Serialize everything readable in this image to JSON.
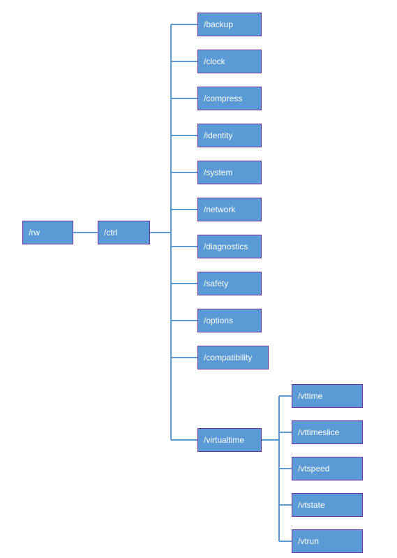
{
  "tree": {
    "root": {
      "label": "/rw",
      "children": [
        {
          "label": "/ctrl",
          "children": [
            {
              "label": "/backup"
            },
            {
              "label": "/clock"
            },
            {
              "label": "/compress"
            },
            {
              "label": "/identity"
            },
            {
              "label": "/system"
            },
            {
              "label": "/network"
            },
            {
              "label": "/diagnostics"
            },
            {
              "label": "/safety"
            },
            {
              "label": "/options"
            },
            {
              "label": "/compatibility"
            },
            {
              "label": "/virtualtime",
              "children": [
                {
                  "label": "/vttime"
                },
                {
                  "label": "/vttimeslice"
                },
                {
                  "label": "/vtspeed"
                },
                {
                  "label": "/vtstate"
                },
                {
                  "label": "/vtrun"
                }
              ]
            }
          ]
        }
      ]
    }
  },
  "colors": {
    "node_fill": "#5b9bd5",
    "node_border": "#7030a0",
    "connector": "#5b9bd5"
  },
  "chart_data": {
    "type": "table",
    "title": "Path hierarchy",
    "rows": [
      {
        "path": "/rw"
      },
      {
        "path": "/rw/ctrl"
      },
      {
        "path": "/rw/ctrl/backup"
      },
      {
        "path": "/rw/ctrl/clock"
      },
      {
        "path": "/rw/ctrl/compress"
      },
      {
        "path": "/rw/ctrl/identity"
      },
      {
        "path": "/rw/ctrl/system"
      },
      {
        "path": "/rw/ctrl/network"
      },
      {
        "path": "/rw/ctrl/diagnostics"
      },
      {
        "path": "/rw/ctrl/safety"
      },
      {
        "path": "/rw/ctrl/options"
      },
      {
        "path": "/rw/ctrl/compatibility"
      },
      {
        "path": "/rw/ctrl/virtualtime"
      },
      {
        "path": "/rw/ctrl/virtualtime/vttime"
      },
      {
        "path": "/rw/ctrl/virtualtime/vttimeslice"
      },
      {
        "path": "/rw/ctrl/virtualtime/vtspeed"
      },
      {
        "path": "/rw/ctrl/virtualtime/vtstate"
      },
      {
        "path": "/rw/ctrl/virtualtime/vtrun"
      }
    ]
  }
}
